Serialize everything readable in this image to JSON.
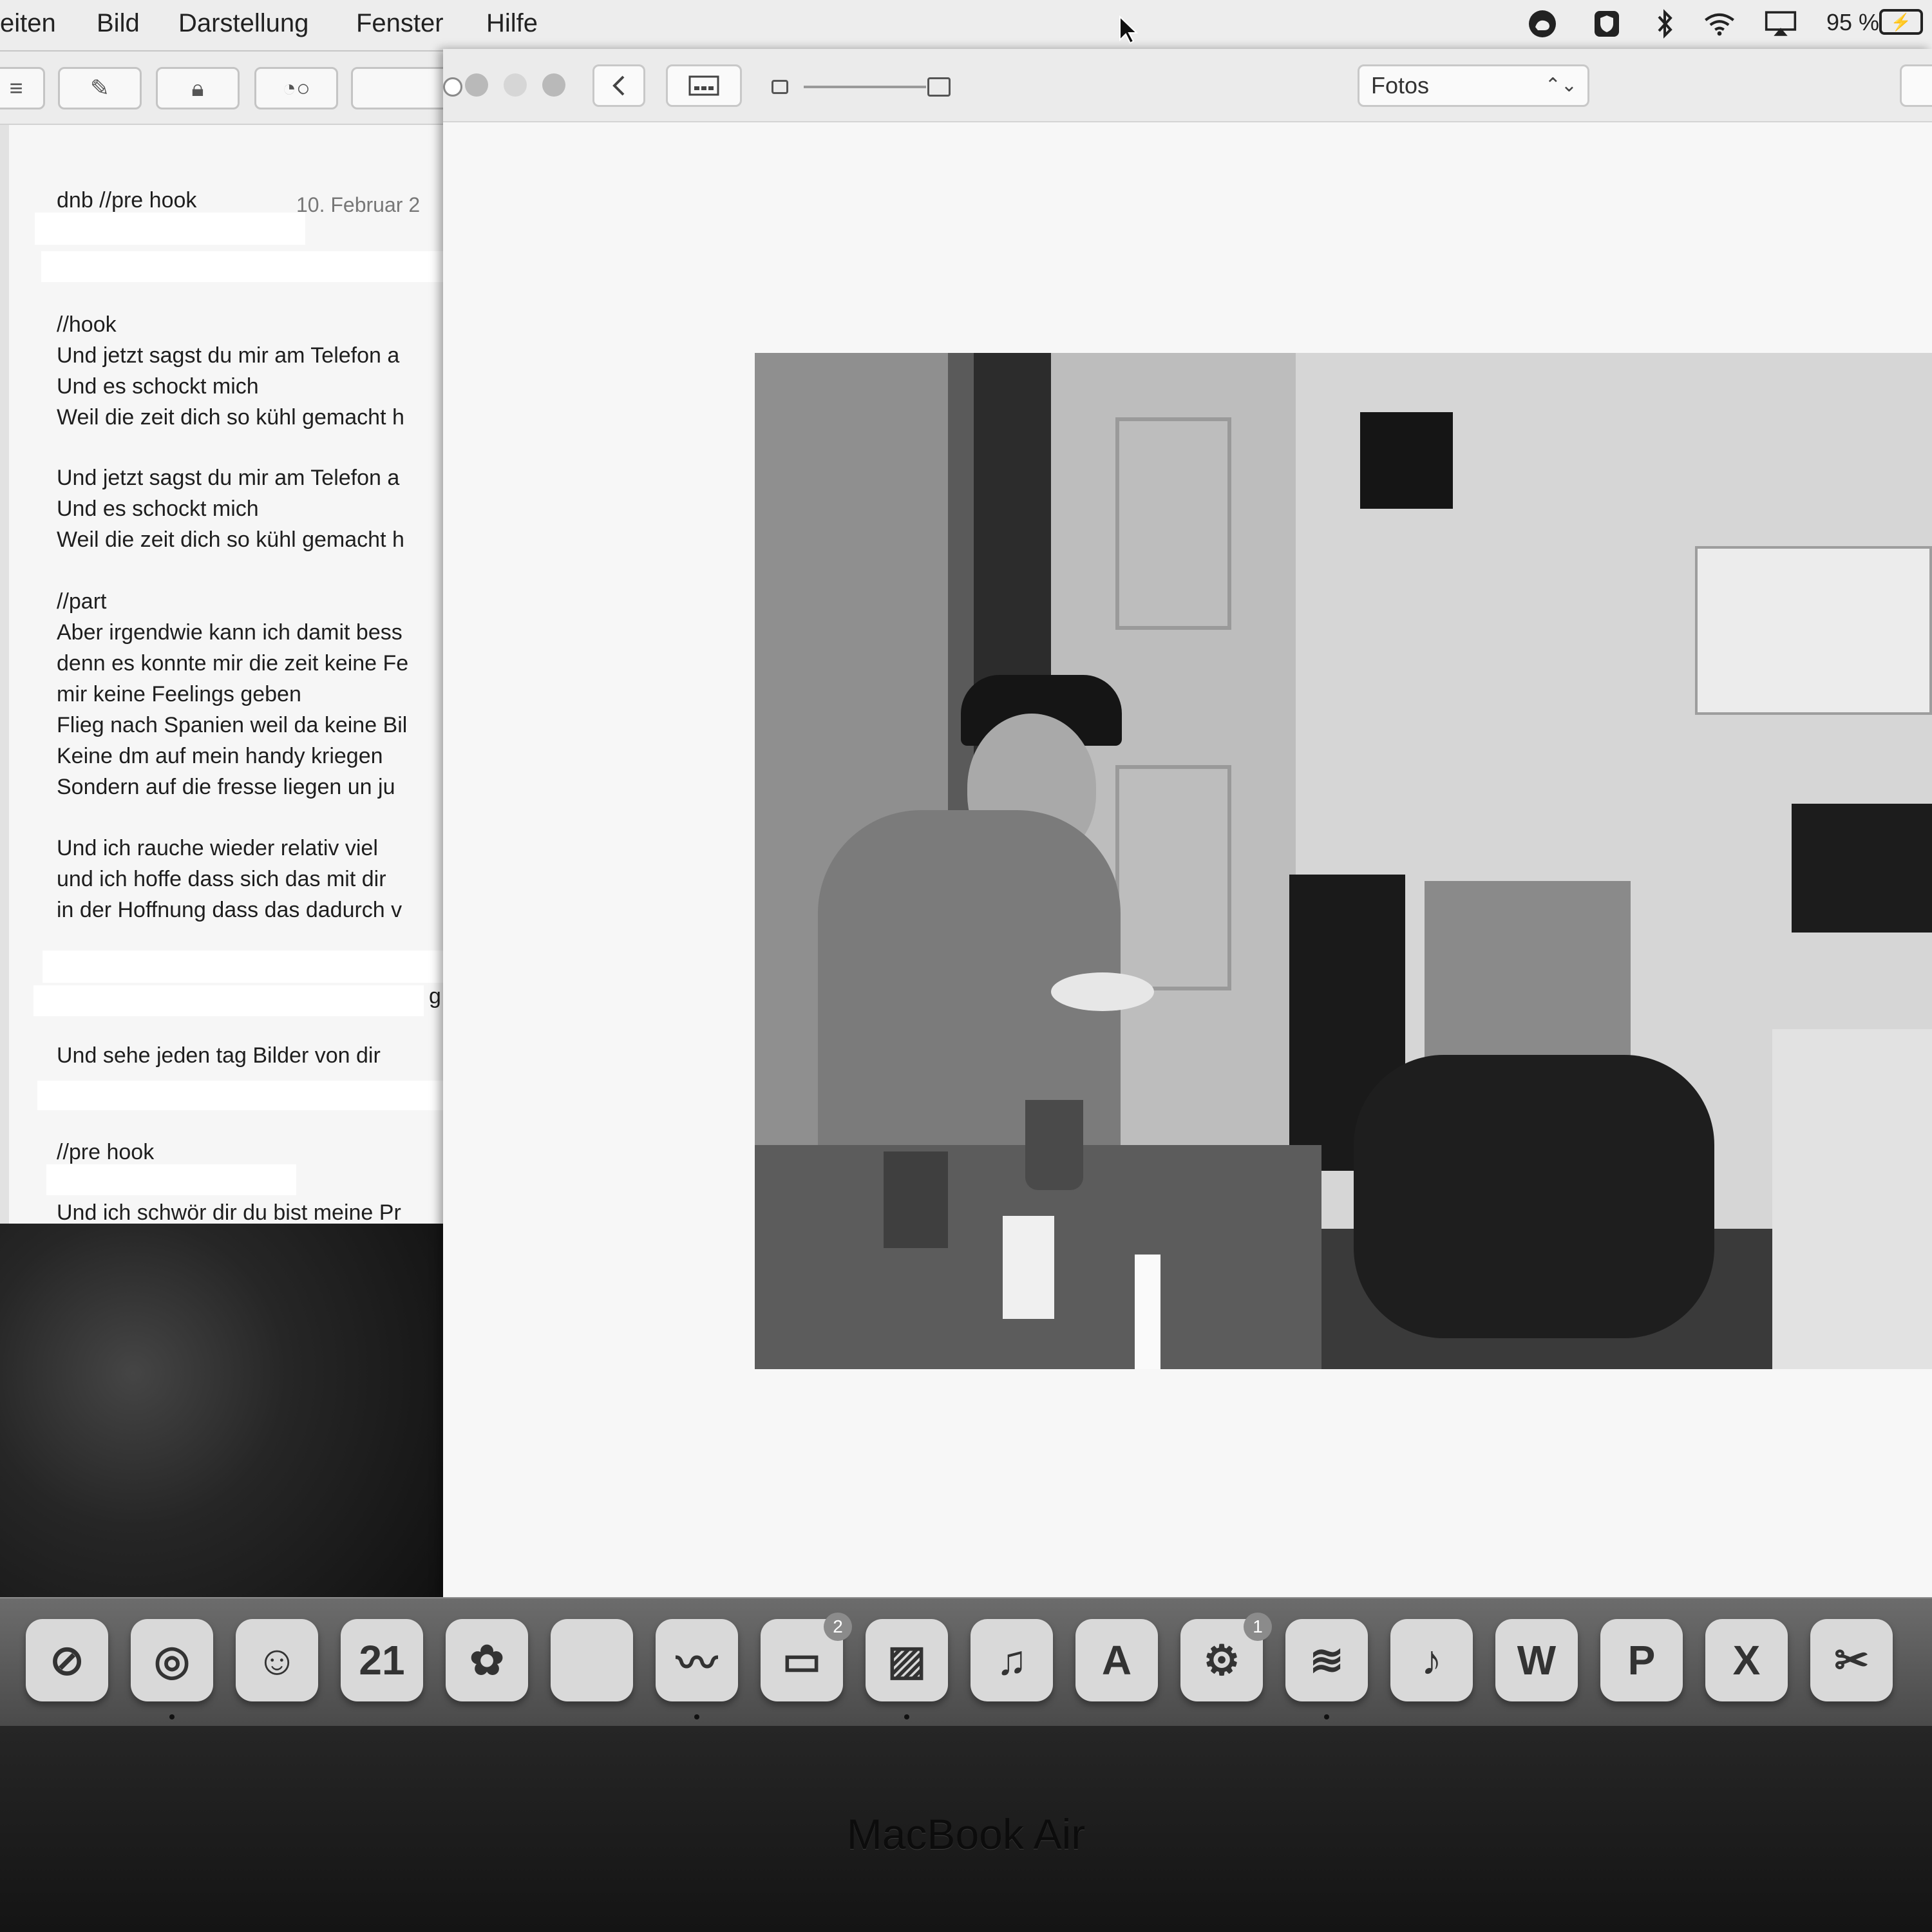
{
  "menubar": {
    "items": [
      "eiten",
      "Bild",
      "Darstellung",
      "Fenster",
      "Hilfe"
    ],
    "status_icons": [
      "creative-cloud-icon",
      "shield-icon",
      "bluetooth-icon",
      "wifi-icon",
      "airplay-icon"
    ],
    "battery": "95 %"
  },
  "notes": {
    "date": "10. Februar 2",
    "lines": [
      "dnb //pre hook",
      "//hook",
      "Und jetzt sagst du mir am Telefon a",
      "Und es schockt mich",
      "Weil die zeit dich so kühl gemacht h",
      "Und jetzt sagst du mir am Telefon a",
      "Und es schockt mich",
      "Weil die zeit dich so kühl gemacht h",
      "//part",
      "Aber irgendwie kann ich damit bess",
      "denn es konnte mir die zeit keine Fe",
      "mir keine Feelings geben",
      "Flieg nach Spanien weil da keine Bil",
      "Keine dm auf mein handy kriegen",
      "Sondern auf die fresse liegen  un ju",
      "Und ich rauche wieder relativ viel",
      "und ich hoffe dass sich das mit dir",
      "in der Hoffnung dass das dadurch v",
      "g",
      "Und sehe jeden tag Bilder von dir",
      "//pre hook",
      "Und ich schwör dir du bist meine Pr"
    ]
  },
  "preview": {
    "album": "Fotos"
  },
  "dock": {
    "apps": [
      {
        "name": "safari-icon",
        "glyph": "⊘"
      },
      {
        "name": "chrome-icon",
        "glyph": "◎"
      },
      {
        "name": "photo-booth-icon",
        "glyph": "☺"
      },
      {
        "name": "calendar-icon",
        "glyph": "21"
      },
      {
        "name": "photos-icon",
        "glyph": "✿"
      },
      {
        "name": "notes-icon",
        "glyph": ""
      },
      {
        "name": "feather-icon",
        "glyph": "〰"
      },
      {
        "name": "facetime-icon",
        "glyph": "▭",
        "badge": "2"
      },
      {
        "name": "preview-icon",
        "glyph": "▨"
      },
      {
        "name": "itunes-icon",
        "glyph": "♫"
      },
      {
        "name": "app-store-icon",
        "glyph": "A"
      },
      {
        "name": "system-preferences-icon",
        "glyph": "⚙",
        "badge": "1"
      },
      {
        "name": "spotify-icon",
        "glyph": "≋"
      },
      {
        "name": "garageband-icon",
        "glyph": "♪"
      },
      {
        "name": "word-icon",
        "glyph": "W"
      },
      {
        "name": "powerpoint-icon",
        "glyph": "P"
      },
      {
        "name": "excel-icon",
        "glyph": "X"
      },
      {
        "name": "instruments-icon",
        "glyph": "✂"
      }
    ]
  },
  "bezel": {
    "label": "MacBook Air"
  }
}
